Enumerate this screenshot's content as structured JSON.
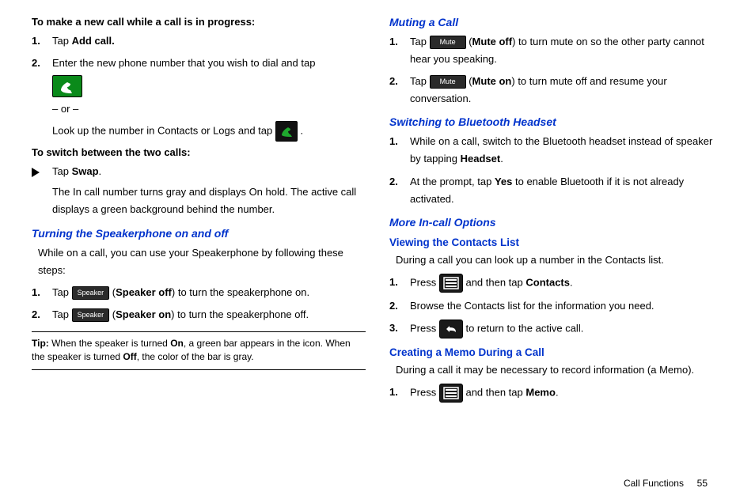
{
  "left": {
    "h1": "To make a new call while a call is in progress:",
    "l1": {
      "num": "1.",
      "a": "Tap ",
      "b": "Add call."
    },
    "l2": {
      "num": "2.",
      "a": "Enter the new phone number that you wish to dial and tap"
    },
    "or": "– or –",
    "lookup_a": "Look up the number in Contacts or Logs and tap ",
    "lookup_b": ".",
    "h2": "To switch between the two calls:",
    "swap_a": "Tap ",
    "swap_b": "Swap",
    "swap_c": ".",
    "swap_desc": "The In call number turns gray and displays On hold. The active call displays a green background behind the number.",
    "h3": "Turning the Speakerphone on and off",
    "spk_intro": "While on a call, you can use your Speakerphone by following these steps:",
    "spk1": {
      "num": "1.",
      "a": "Tap ",
      "btn": "Speaker",
      "b": " (",
      "c": "Speaker off",
      "d": ") to turn the speakerphone on."
    },
    "spk2": {
      "num": "2.",
      "a": "Tap ",
      "btn": "Speaker",
      "b": " (",
      "c": "Speaker on",
      "d": ") to turn the speakerphone off."
    },
    "tip_label": "Tip: ",
    "tip_a": "When the speaker is turned ",
    "tip_b": "On",
    "tip_c": ", a green bar appears in the icon. When the speaker is turned ",
    "tip_d": "Off",
    "tip_e": ", the color of the bar is gray."
  },
  "right": {
    "h1": "Muting a Call",
    "m1": {
      "num": "1.",
      "a": "Tap ",
      "btn": "Mute",
      "b": " (",
      "c": "Mute off",
      "d": ") to turn mute on so the other party cannot hear you speaking."
    },
    "m2": {
      "num": "2.",
      "a": "Tap ",
      "btn": "Mute",
      "b": " (",
      "c": "Mute on",
      "d": ") to turn mute off and resume your conversation."
    },
    "h2": "Switching to Bluetooth Headset",
    "b1": {
      "num": "1.",
      "a": "While on a call, switch to the Bluetooth headset instead of speaker by tapping ",
      "b": "Headset",
      "c": "."
    },
    "b2": {
      "num": "2.",
      "a": "At the prompt, tap ",
      "b": "Yes",
      "c": " to enable Bluetooth if it is not already activated."
    },
    "h3": "More In-call Options",
    "h3a": "Viewing the Contacts List",
    "c_intro": "During a call you can look up a number in the Contacts list.",
    "c1": {
      "num": "1.",
      "a": "Press ",
      "b": " and then tap ",
      "c": "Contacts",
      "d": "."
    },
    "c2": {
      "num": "2.",
      "a": "Browse the Contacts list for the information you need."
    },
    "c3": {
      "num": "3.",
      "a": "Press ",
      "b": " to return to the active call."
    },
    "h3b": "Creating a Memo During a Call",
    "memo_intro": "During a call it may be necessary to record information (a Memo).",
    "memo1": {
      "num": "1.",
      "a": "Press ",
      "b": " and then tap ",
      "c": "Memo",
      "d": "."
    }
  },
  "footer": {
    "section": "Call Functions",
    "page": "55"
  }
}
